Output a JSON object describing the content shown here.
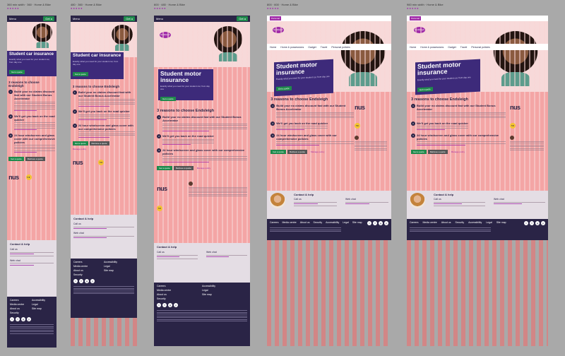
{
  "captions": [
    {
      "top": "360 min width · 360 · Home & Bike",
      "sub": "● ●   ● ● ●"
    },
    {
      "top": "480 · 360 · Home & Bike",
      "sub": "● ●   ● ● ●"
    },
    {
      "top": "600 · 480 · Home & Bike",
      "sub": "● ●   ● ● ●"
    },
    {
      "top": "800 · 600 · Home & Bike",
      "sub": "● ●   ● ● ●"
    },
    {
      "top": "960 min width · Home & Bike",
      "sub": "● ●   ● ● ●"
    }
  ],
  "colors": {
    "navy": "#2a2446",
    "purple": "#3d2a7a",
    "green": "#1f8a4c",
    "magenta": "#a02aa8",
    "grid": "#f4a5a5"
  },
  "header": {
    "menu": "Menu",
    "get_quote": "Get a"
  },
  "nav": {
    "items": [
      "Home",
      "Home & possessions",
      "Gadget",
      "Travel",
      "Personal policies"
    ],
    "strip": "Personal"
  },
  "logo": "Endsleigh",
  "hero": {
    "title_short": "Student car insurance",
    "title_long": "Student motor insurance",
    "sub": "Exactly what you need for your student car, from day one",
    "cta": "Get a quote"
  },
  "reasons": {
    "heading": "3 reasons to choose Endsleigh",
    "items": [
      {
        "n": "1",
        "text": "Build your no claims discount fast with our Student Bonus Accelerator"
      },
      {
        "n": "2",
        "text": "We'll get you back on the road quicker"
      },
      {
        "n": "3",
        "text": "24 hour windscreen and glass cover with our comprehensive policies"
      }
    ]
  },
  "buttons": {
    "quote": "Get a quote",
    "retrieve": "Retrieve a quote",
    "link": "Manage policy"
  },
  "partners": {
    "nus": "nus",
    "badge": "5★"
  },
  "contact": {
    "heading": "Contact & help",
    "call": "Call us",
    "webchat": "Web chat"
  },
  "footer": {
    "links": [
      "Careers",
      "Media centre",
      "About us",
      "Security",
      "Accessibility",
      "Legal",
      "Site map"
    ]
  },
  "social": [
    "t",
    "f",
    "g",
    "y"
  ]
}
